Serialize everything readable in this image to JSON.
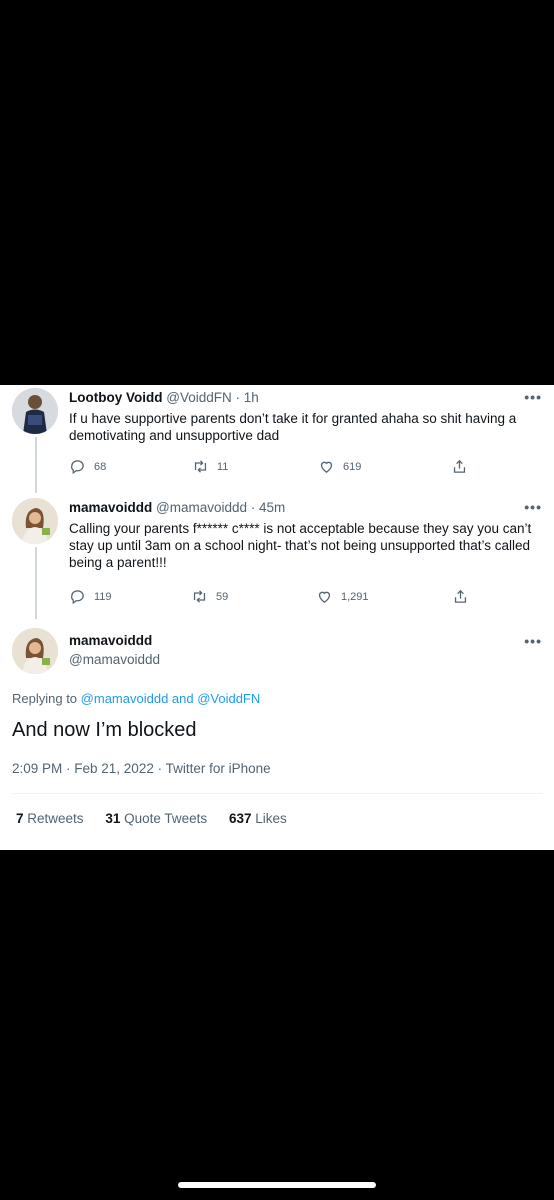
{
  "tweets": [
    {
      "name": "Lootboy Voidd",
      "handle_time": "@VoiddFN · 1h",
      "text": "If u have supportive parents don’t take it for granted ahaha so shit having a demotivating and unsupportive dad",
      "reply_count": "68",
      "retweet_count": "11",
      "like_count": "619"
    },
    {
      "name": "mamavoiddd",
      "handle_time": "@mamavoiddd · 45m",
      "text": "Calling your parents f****** c**** is not acceptable because they say you can’t stay up until 3am on a school night- that’s not being unsupported that’s called being a parent!!!",
      "reply_count": "119",
      "retweet_count": "59",
      "like_count": "1,291"
    }
  ],
  "main_tweet": {
    "name": "mamavoiddd",
    "handle": "@mamavoiddd",
    "replying_prefix": "Replying to",
    "replying_to": "@mamavoiddd and @VoiddFN",
    "text": "And now I’m blocked",
    "meta": "2:09 PM · Feb 21, 2022 · Twitter for iPhone",
    "stats": {
      "retweets_count": "7",
      "retweets_label": "Retweets",
      "quotes_count": "31",
      "quotes_label": "Quote Tweets",
      "likes_count": "637",
      "likes_label": "Likes"
    }
  },
  "more_label": "•••",
  "icons": [
    "reply-icon",
    "retweet-icon",
    "like-icon",
    "share-icon",
    "more-icon"
  ]
}
